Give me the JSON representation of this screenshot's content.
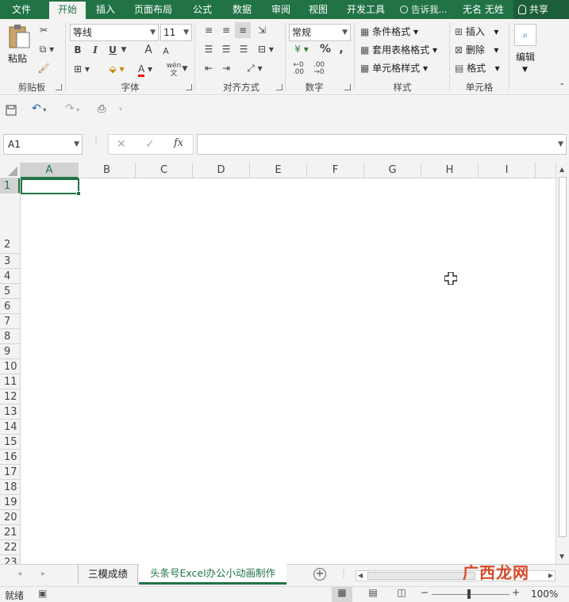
{
  "tabs": [
    {
      "label": "文件"
    },
    {
      "label": "开始"
    },
    {
      "label": "插入"
    },
    {
      "label": "页面布局"
    },
    {
      "label": "公式"
    },
    {
      "label": "数据"
    },
    {
      "label": "审阅"
    },
    {
      "label": "视图"
    },
    {
      "label": "开发工具"
    }
  ],
  "tellme": "告诉我...",
  "user": "无名 无姓",
  "share": "共享",
  "clipboard": {
    "paste": "粘贴",
    "label": "剪贴板"
  },
  "font": {
    "name": "等线",
    "size": "11",
    "bold": "B",
    "italic": "I",
    "underline": "U",
    "grow": "A",
    "shrink": "A",
    "phonetic": "wén",
    "label": "字体"
  },
  "align": {
    "label": "对齐方式"
  },
  "number": {
    "format": "常规",
    "percent": "%",
    "comma": ",",
    "label": "数字"
  },
  "styles": {
    "cond": "条件格式",
    "table": "套用表格格式",
    "cell": "单元格样式",
    "label": "样式"
  },
  "cells": {
    "insert": "插入",
    "delete": "删除",
    "format": "格式",
    "label": "单元格"
  },
  "editing": {
    "label": "编辑"
  },
  "formula": {
    "namebox": "A1",
    "fx": "fx",
    "value": ""
  },
  "columns": [
    "A",
    "B",
    "C",
    "D",
    "E",
    "F",
    "G",
    "H",
    "I"
  ],
  "rows": [
    "1",
    "2",
    "3",
    "4",
    "5",
    "6",
    "7",
    "8",
    "9",
    "10",
    "11",
    "12",
    "13",
    "14",
    "15",
    "16",
    "17",
    "18",
    "19",
    "20",
    "21",
    "22",
    "23"
  ],
  "sheets": [
    {
      "label": "三模成绩"
    },
    {
      "label": "头条号Excel办公小动画制作"
    }
  ],
  "status": {
    "ready": "就绪",
    "zoom": "100%"
  },
  "watermark": "广西龙网"
}
